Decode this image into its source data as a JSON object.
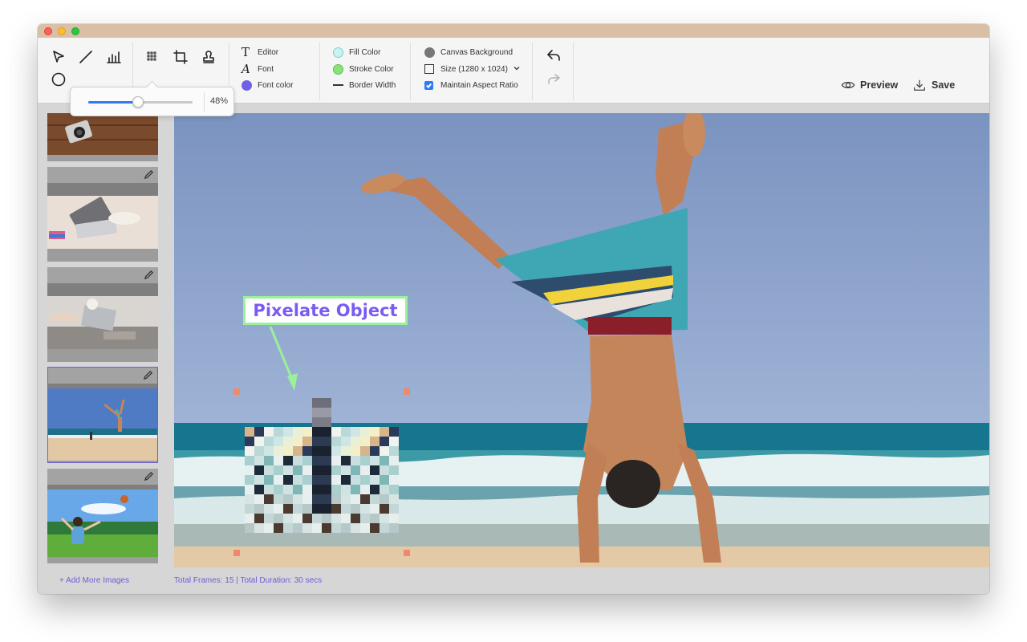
{
  "window": {
    "traffic_lights": [
      "close",
      "minimize",
      "zoom"
    ]
  },
  "toolbar": {
    "tools_row1": [
      "select-arrow-icon",
      "line-icon",
      "chart-bars-icon"
    ],
    "tools_row1b": [
      "pixelate-icon",
      "crop-icon",
      "stamp-icon"
    ],
    "tools_row2": [
      "circle-icon"
    ],
    "text_group": {
      "editor_label": "Editor",
      "font_label": "Font",
      "font_color_label": "Font color",
      "font_color": "#7060e8"
    },
    "color_group": {
      "fill_label": "Fill Color",
      "fill_color": "#c8f3f3",
      "stroke_label": "Stroke Color",
      "stroke_color": "#8ce27a",
      "border_label": "Border Width"
    },
    "canvas_group": {
      "background_label": "Canvas Background",
      "background_color": "#777777",
      "size_label": "Size (1280 x 1024)",
      "aspect_label": "Maintain Aspect Ratio",
      "aspect_checked": true
    },
    "preview_label": "Preview",
    "save_label": "Save"
  },
  "slider_popover": {
    "value_text": "48%",
    "value": 0.48
  },
  "sidebar": {
    "thumbnails": [
      "camera-on-wood",
      "laptop-desk",
      "laptop-work",
      "beach-handstand",
      "park-girl"
    ],
    "selected_index": 3,
    "add_more_label": "+ Add More Images"
  },
  "canvas": {
    "callout_text": "Pixelate Object",
    "accent_color": "#9bf09b",
    "callout_text_color": "#7b5cf0"
  },
  "footer": {
    "frames_text": "Total Frames: 15  |  Total Duration: 30 secs"
  }
}
